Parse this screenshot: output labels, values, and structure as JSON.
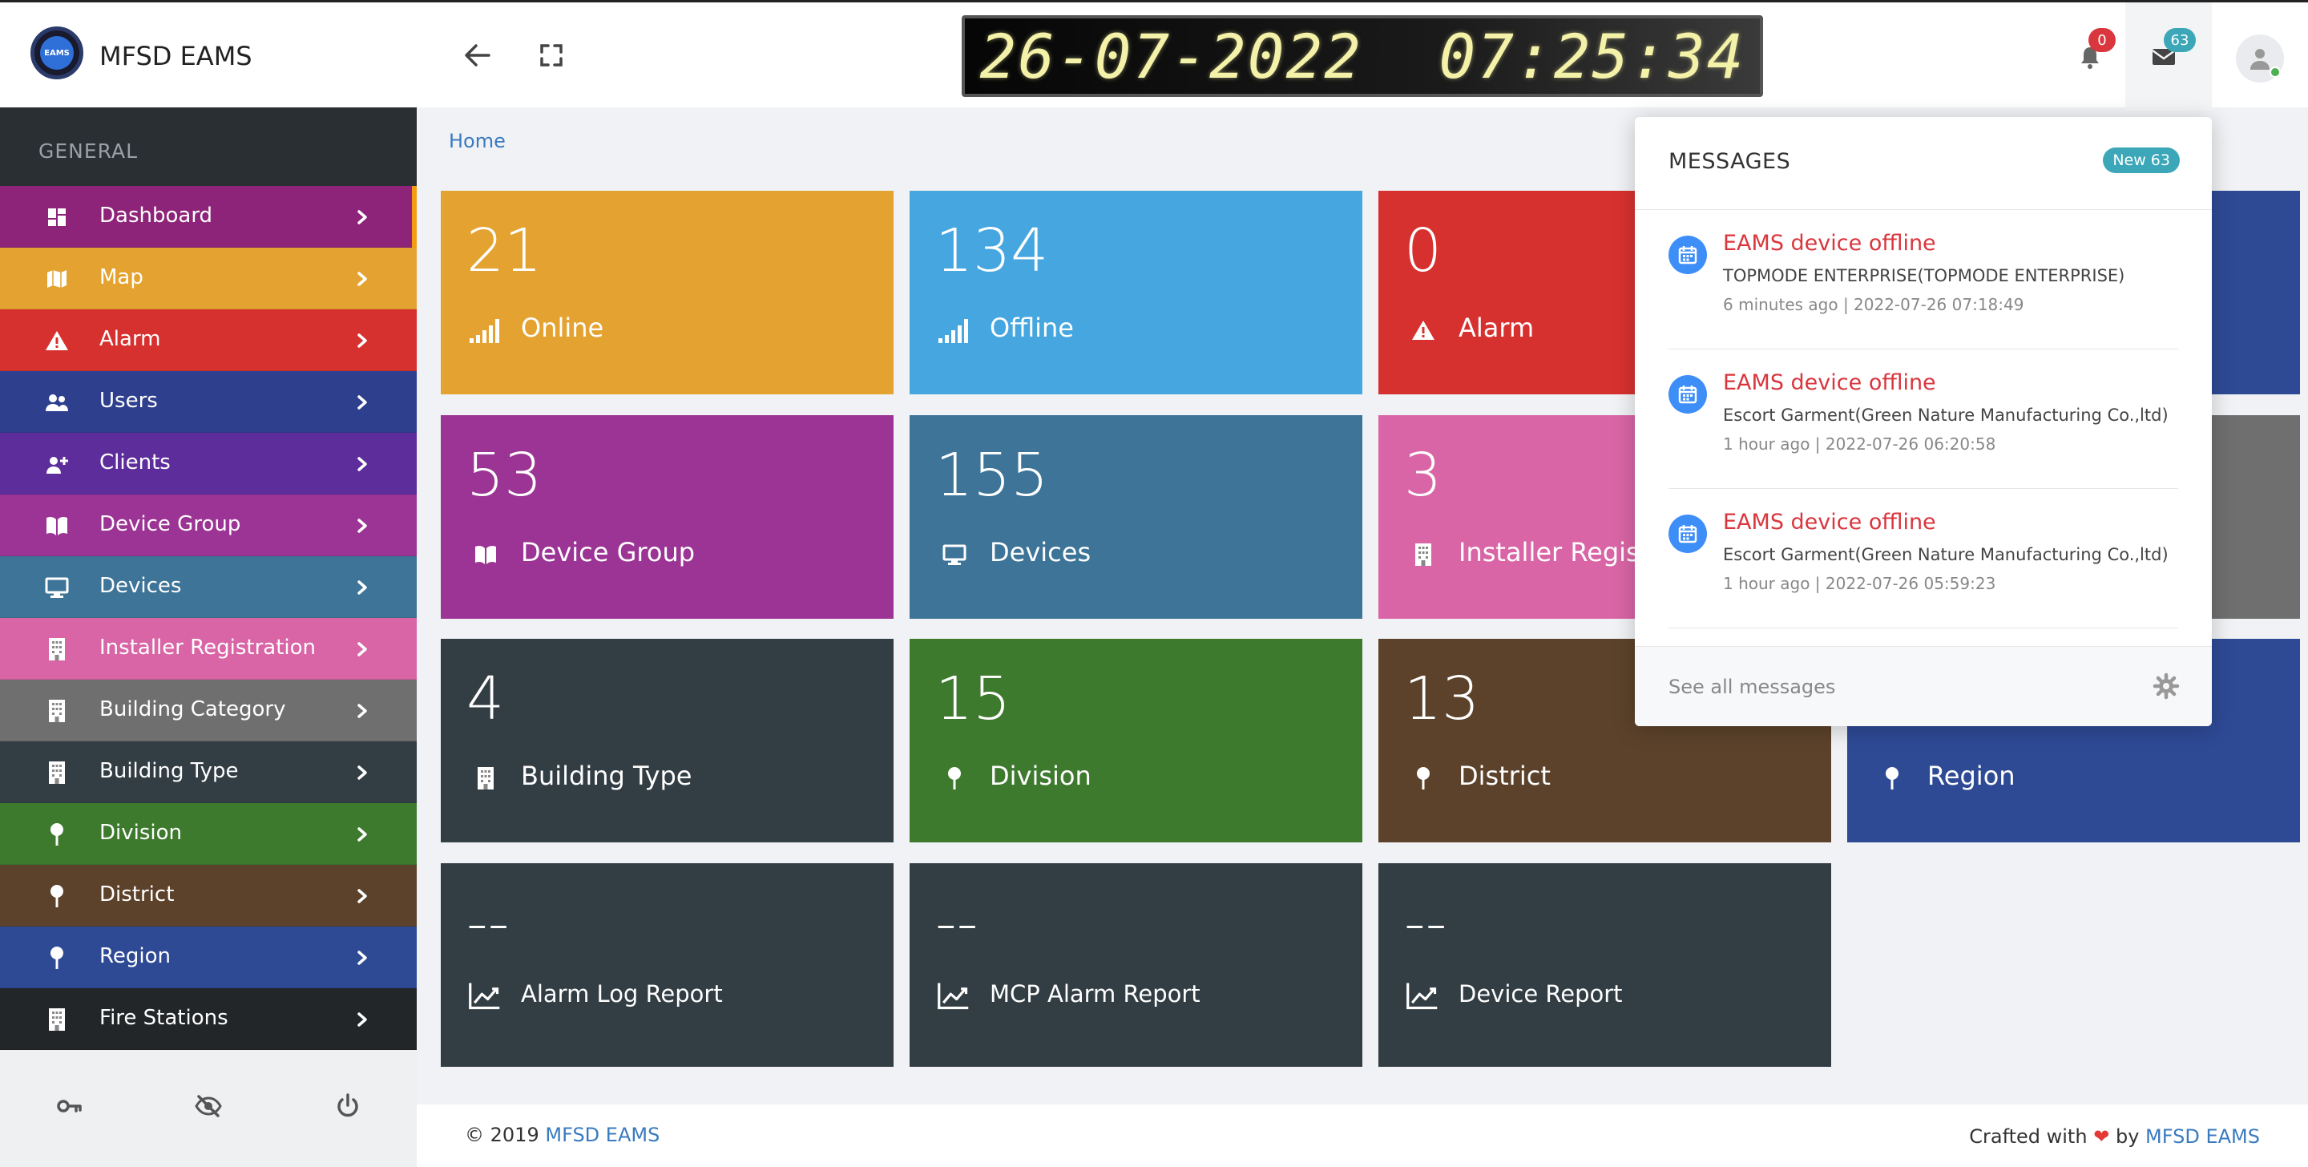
{
  "header": {
    "app_title": "MFSD EAMS",
    "logo_text": "EAMS",
    "clock": "26-07-2022  07:25:34",
    "notification_count": "0",
    "message_count": "63"
  },
  "sidebar": {
    "heading": "GENERAL",
    "items": [
      {
        "label": "Dashboard",
        "icon": "dashboard-icon",
        "color": "#8e2479"
      },
      {
        "label": "Map",
        "icon": "map-icon",
        "color": "#e4a331"
      },
      {
        "label": "Alarm",
        "icon": "warning-icon",
        "color": "#d7312f"
      },
      {
        "label": "Users",
        "icon": "users-icon",
        "color": "#2e3f8e"
      },
      {
        "label": "Clients",
        "icon": "add-user-icon",
        "color": "#5d2e9b"
      },
      {
        "label": "Device Group",
        "icon": "book-icon",
        "color": "#9b3494"
      },
      {
        "label": "Devices",
        "icon": "monitor-icon",
        "color": "#3d7498"
      },
      {
        "label": "Installer Registration",
        "icon": "building-icon",
        "color": "#d965a6"
      },
      {
        "label": "Building Category",
        "icon": "building-icon",
        "color": "#6f6f6f"
      },
      {
        "label": "Building Type",
        "icon": "building-icon",
        "color": "#323d44"
      },
      {
        "label": "Division",
        "icon": "pin-icon",
        "color": "#3e7a2e"
      },
      {
        "label": "District",
        "icon": "pin-icon",
        "color": "#5c422b"
      },
      {
        "label": "Region",
        "icon": "pin-icon",
        "color": "#2e4a95"
      },
      {
        "label": "Fire Stations",
        "icon": "building-icon",
        "color": "#222629"
      }
    ],
    "footer_icons": [
      "key-icon",
      "eye-slash-icon",
      "power-icon"
    ]
  },
  "breadcrumb": "Home",
  "cards": [
    {
      "value": "21",
      "label": "Online",
      "icon": "signal-icon",
      "color": "#e4a331"
    },
    {
      "value": "134",
      "label": "Offline",
      "icon": "signal-icon",
      "color": "#45a6e0"
    },
    {
      "value": "0",
      "label": "Alarm",
      "icon": "warning-icon",
      "color": "#d7312f"
    },
    {
      "value": "",
      "label": "",
      "icon": "",
      "color": "#2e4a95"
    },
    {
      "value": "53",
      "label": "Device Group",
      "icon": "book-icon",
      "color": "#9b3494"
    },
    {
      "value": "155",
      "label": "Devices",
      "icon": "monitor-icon",
      "color": "#3d7498"
    },
    {
      "value": "3",
      "label": "Installer Registration",
      "icon": "building-icon",
      "color": "#d965a6"
    },
    {
      "value": "",
      "label": "",
      "icon": "",
      "color": "#6f6f6f"
    },
    {
      "value": "4",
      "label": "Building Type",
      "icon": "building-icon",
      "color": "#323d44"
    },
    {
      "value": "15",
      "label": "Division",
      "icon": "pin-icon",
      "color": "#3e7a2e"
    },
    {
      "value": "13",
      "label": "District",
      "icon": "pin-icon",
      "color": "#5c422b"
    },
    {
      "value": "",
      "label": "Region",
      "icon": "pin-icon",
      "color": "#2e4a95"
    },
    {
      "value": "--",
      "label": "Alarm Log Report",
      "icon": "chart-line-icon",
      "color": "#323d44"
    },
    {
      "value": "--",
      "label": "MCP Alarm Report",
      "icon": "chart-line-icon",
      "color": "#323d44"
    },
    {
      "value": "--",
      "label": "Device Report",
      "icon": "chart-line-icon",
      "color": "#323d44"
    }
  ],
  "messages": {
    "title": "MESSAGES",
    "new_badge": "New 63",
    "items": [
      {
        "title": "EAMS device offline",
        "body": "TOPMODE ENTERPRISE(TOPMODE ENTERPRISE)",
        "time": "6 minutes ago | 2022-07-26 07:18:49"
      },
      {
        "title": "EAMS device offline",
        "body": "Escort Garment(Green Nature Manufacturing Co.,ltd)",
        "time": "1 hour ago | 2022-07-26 06:20:58"
      },
      {
        "title": "EAMS device offline",
        "body": "Escort Garment(Green Nature Manufacturing Co.,ltd)",
        "time": "1 hour ago | 2022-07-26 05:59:23"
      }
    ],
    "see_all": "See all messages"
  },
  "footer": {
    "copyright_prefix": "© 2019",
    "copyright_link": "MFSD EAMS",
    "crafted_prefix": "Crafted with",
    "crafted_by": "by",
    "crafted_link": "MFSD EAMS"
  }
}
